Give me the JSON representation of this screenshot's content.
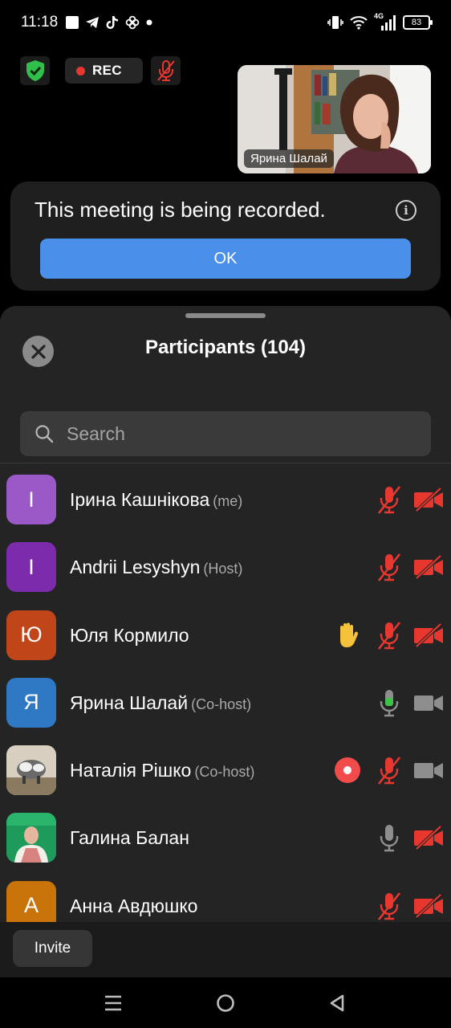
{
  "status_bar": {
    "time": "11:18",
    "network": "4G",
    "battery": "83"
  },
  "meeting": {
    "rec_label": "REC",
    "video_tile_name": "Ярина Шалай"
  },
  "recording_banner": {
    "message": "This meeting is being recorded.",
    "ok_label": "OK"
  },
  "participants_panel": {
    "title": "Participants (104)",
    "search_placeholder": "Search",
    "invite_label": "Invite",
    "participants": [
      {
        "initial": "І",
        "name": "Ірина Кашнікова",
        "role": "(me)",
        "avatar_color": "#9b59c8",
        "extra": "",
        "mic": "muted",
        "cam": "off"
      },
      {
        "initial": "I",
        "name": "Andrii Lesyshyn",
        "role": "(Host)",
        "avatar_color": "#7b2bab",
        "extra": "",
        "mic": "muted",
        "cam": "off"
      },
      {
        "initial": "Ю",
        "name": "Юля Кормило",
        "role": "",
        "avatar_color": "#c0461a",
        "extra": "raised-hand",
        "mic": "muted",
        "cam": "off"
      },
      {
        "initial": "Я",
        "name": "Ярина Шалай",
        "role": "(Co-host)",
        "avatar_color": "#2f78c4",
        "extra": "",
        "mic": "speaking",
        "cam": "on"
      },
      {
        "initial": "",
        "name": "Наталія Рішко",
        "role": "(Co-host)",
        "avatar_color": "#8a8070",
        "extra": "recording",
        "mic": "muted",
        "cam": "on"
      },
      {
        "initial": "",
        "name": "Галина Балан",
        "role": "",
        "avatar_color": "#1e9a5a",
        "extra": "",
        "mic": "unmuted",
        "cam": "off"
      },
      {
        "initial": "А",
        "name": "Анна Авдюшко",
        "role": "",
        "avatar_color": "#c8740a",
        "extra": "",
        "mic": "muted",
        "cam": "off"
      }
    ]
  },
  "colors": {
    "accent_blue": "#4a90ea",
    "muted_red": "#e8372f",
    "speaking_green": "#3ec24a",
    "hand_yellow": "#f5c23b"
  }
}
